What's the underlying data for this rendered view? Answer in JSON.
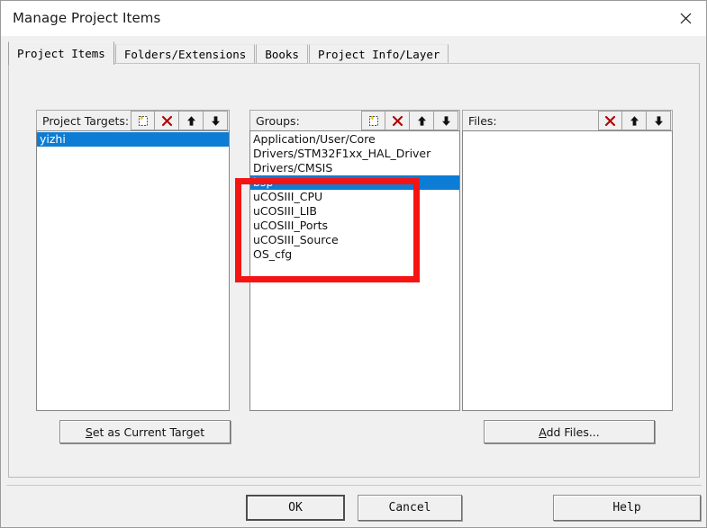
{
  "window": {
    "title": "Manage Project Items",
    "close_icon": "close-icon"
  },
  "tabs": [
    {
      "label": "Project Items",
      "selected": true
    },
    {
      "label": "Folders/Extensions",
      "selected": false
    },
    {
      "label": "Books",
      "selected": false
    },
    {
      "label": "Project Info/Layer",
      "selected": false
    }
  ],
  "columns": {
    "project_targets": {
      "header": "Project Targets:",
      "tools": [
        "new-item-icon",
        "delete-icon",
        "move-up-icon",
        "move-down-icon"
      ],
      "items": [
        {
          "label": "yizhi",
          "selected": true
        }
      ]
    },
    "groups": {
      "header": "Groups:",
      "tools": [
        "new-item-icon",
        "delete-icon",
        "move-up-icon",
        "move-down-icon"
      ],
      "items": [
        {
          "label": "Application/User/Core",
          "selected": false
        },
        {
          "label": "Drivers/STM32F1xx_HAL_Driver",
          "selected": false
        },
        {
          "label": "Drivers/CMSIS",
          "selected": false
        },
        {
          "label": "bsp",
          "selected": true
        },
        {
          "label": "uCOSIII_CPU",
          "selected": false
        },
        {
          "label": "uCOSIII_LIB",
          "selected": false
        },
        {
          "label": "uCOSIII_Ports",
          "selected": false
        },
        {
          "label": "uCOSIII_Source",
          "selected": false
        },
        {
          "label": "OS_cfg",
          "selected": false
        }
      ]
    },
    "files": {
      "header": "Files:",
      "tools": [
        "delete-icon",
        "move-up-icon",
        "move-down-icon"
      ],
      "items": []
    }
  },
  "actions": {
    "set_as_current_target": {
      "pre": "S",
      "post": "et as Current Target"
    },
    "add_files": {
      "pre": "A",
      "post": "dd Files..."
    }
  },
  "footer": {
    "ok": "OK",
    "cancel": "Cancel",
    "help": "Help"
  },
  "colors": {
    "selection_blue": "#0c7cd5",
    "annotation_red": "#f51414",
    "delete_x_red": "#b00000",
    "dialog_face": "#f0f0f0"
  }
}
